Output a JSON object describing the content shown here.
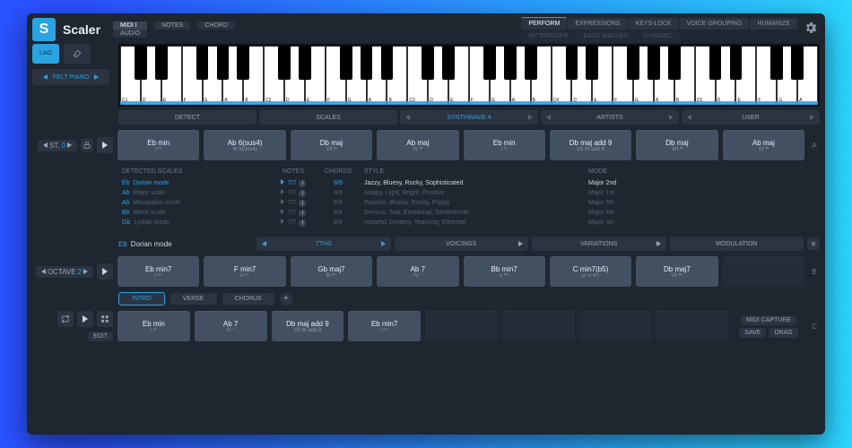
{
  "brand": "Scaler",
  "header": {
    "input_tabs": {
      "midi": "MIDI I",
      "audio": "AUDIO"
    },
    "info_tabs": {
      "notes": "NOTES",
      "chord": "CHORD"
    },
    "right": {
      "perform": "PERFORM",
      "expressions": "EXPRESSIONS",
      "keyslock": "KEYS-LOCK",
      "voicegrouping": "VOICE GROUPING",
      "humanize": "HUMANIZE",
      "row2a": "MY TRIGGER",
      "row2b": "BASS WALKER",
      "row2c": "DYNAMIC"
    }
  },
  "felt_piano": "FELT PIANO",
  "tool_labels": {
    "liao": "LIAO"
  },
  "nav": {
    "detect": "DETECT",
    "scales": "SCALES",
    "songs": "SYNTHWAVE 4",
    "artists": "ARTISTS",
    "user": "USER"
  },
  "st": {
    "label": "ST.",
    "value": "0"
  },
  "chordsA": [
    {
      "main": "Eb min",
      "sub": "i ᵐ"
    },
    {
      "main": "Ab 6(sus4)",
      "sub": "IV 6(sus4)"
    },
    {
      "main": "Db maj",
      "sub": "VII ᴹ"
    },
    {
      "main": "Ab maj",
      "sub": "IV ᴹ"
    },
    {
      "main": "Eb min",
      "sub": "i ᵐ"
    },
    {
      "main": "Db maj add 9",
      "sub": "VII M add 9"
    },
    {
      "main": "Db maj",
      "sub": "VII ᴹ"
    },
    {
      "main": "Ab maj",
      "sub": "IV ᴹ"
    }
  ],
  "section_letters": {
    "a": "A",
    "b": "B",
    "c": "C"
  },
  "scales": {
    "headers": {
      "detected": "DETECTED SCALES",
      "notes": "NOTES",
      "chords": "CHORDS",
      "style": "STYLE",
      "mode": "MODE"
    },
    "rows": [
      {
        "root": "Eb",
        "name": "Dorian mode",
        "notes": "7/7",
        "ch": "8/8",
        "style": "Jazzy, Bluesy, Rocky, Sophisticated",
        "mode": "Major 2nd",
        "sel": true
      },
      {
        "root": "Ab",
        "name": "Major scale",
        "notes": "7/7",
        "ch": "8/8",
        "style": "Happy, Light, Bright, Positive",
        "mode": "Major 1st"
      },
      {
        "root": "Ab",
        "name": "Mixolydian mode",
        "notes": "7/7",
        "ch": "8/8",
        "style": "Positive, Bluesy, Rocky, Poppy",
        "mode": "Major 5th"
      },
      {
        "root": "Bb",
        "name": "Minor scale",
        "notes": "7/7",
        "ch": "8/8",
        "style": "Serious, Sad, Emotional, Sentimental",
        "mode": "Major 6th"
      },
      {
        "root": "Gb",
        "name": "Lydian mode",
        "notes": "7/7",
        "ch": "8/8",
        "style": "Hopeful, Dreamy, Yearning, Ethereal",
        "mode": "Major 4th"
      }
    ]
  },
  "mod": {
    "root": "Eb",
    "name": "Dorian mode",
    "sevenths": "7THS",
    "voicings": "VOICINGS",
    "variations": "VARIATIONS",
    "modulation": "MODULATION"
  },
  "octave": {
    "label": "OCTAVE",
    "value": "2"
  },
  "chordsB": [
    {
      "main": "Eb min7",
      "sub": "i ᵐ⁷"
    },
    {
      "main": "F min7",
      "sub": "ii ᵐ⁷"
    },
    {
      "main": "Gb maj7",
      "sub": "III ᴹ⁷"
    },
    {
      "main": "Ab 7",
      "sub": "IV ⁷"
    },
    {
      "main": "Bb min7",
      "sub": "v ᵐ⁷"
    },
    {
      "main": "C min7(b5)",
      "sub": "vi ᵐ⁷⁽ᵇ⁵⁾"
    },
    {
      "main": "Db maj7",
      "sub": "VII ᴹ⁷"
    }
  ],
  "sections": {
    "intro": "INTRO",
    "verse": "VERSE",
    "chorus": "CHORUS"
  },
  "chordsC": [
    {
      "main": "Eb min",
      "sub": "i ᵐ"
    },
    {
      "main": "Ab 7",
      "sub": "IV ⁷"
    },
    {
      "main": "Db maj add 9",
      "sub": "VII M add 9"
    },
    {
      "main": "Eb min7",
      "sub": "i ᵐ⁷"
    }
  ],
  "bottom": {
    "edit": "EDIT",
    "midicap": "MIDI CAPTURE",
    "save": "SAVE",
    "drag": "DRAG"
  },
  "kb_labels": [
    "C1",
    "D",
    "E",
    "F",
    "G",
    "A",
    "B",
    "C2",
    "D",
    "E",
    "F",
    "G",
    "A",
    "B",
    "C3",
    "D",
    "E",
    "F",
    "G",
    "A",
    "B",
    "C4",
    "D",
    "E",
    "F",
    "G",
    "A",
    "B",
    "C5",
    "D",
    "E",
    "F",
    "G",
    "A"
  ]
}
